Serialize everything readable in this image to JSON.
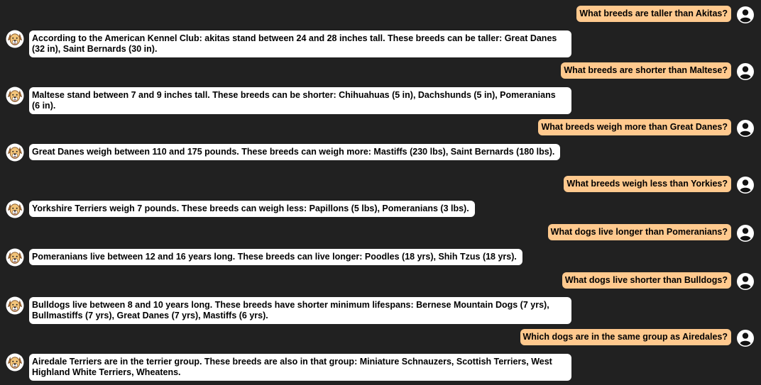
{
  "messages": [
    {
      "role": "user",
      "text": "What breeds are taller than Akitas?"
    },
    {
      "role": "bot",
      "text": "According to the American Kennel Club: akitas stand between 24 and 28 inches tall. These breeds can be taller: Great Danes (32 in), Saint Bernards (30 in)."
    },
    {
      "role": "user",
      "text": "What breeds are shorter than Maltese?"
    },
    {
      "role": "bot",
      "text": "Maltese stand between 7 and 9 inches tall. These breeds can be shorter: Chihuahuas (5 in), Dachshunds (5 in), Pomeranians (6 in)."
    },
    {
      "role": "user",
      "text": "What breeds weigh more than Great Danes?"
    },
    {
      "role": "bot",
      "text": "Great Danes weigh between 110 and 175 pounds. These breeds can weigh more: Mastiffs (230 lbs), Saint Bernards (180 lbs)."
    },
    {
      "role": "user",
      "text": "What breeds weigh less than Yorkies?"
    },
    {
      "role": "bot",
      "text": "Yorkshire Terriers weigh 7 pounds. These breeds can weigh less: Papillons (5 lbs), Pomeranians (3 lbs)."
    },
    {
      "role": "user",
      "text": "What dogs live longer than Pomeranians?"
    },
    {
      "role": "bot",
      "text": "Pomeranians live between 12 and 16 years long. These breeds can live longer: Poodles (18 yrs), Shih Tzus (18 yrs)."
    },
    {
      "role": "user",
      "text": "What dogs live shorter than Bulldogs?"
    },
    {
      "role": "bot",
      "text": "Bulldogs live between 8 and 10 years long. These breeds have shorter minimum lifespans: Bernese Mountain Dogs (7 yrs), Bullmastiffs (7 yrs), Great Danes (7 yrs), Mastiffs (6 yrs)."
    },
    {
      "role": "user",
      "text": "Which dogs are in the same group as Airedales?"
    },
    {
      "role": "bot",
      "text": "Airedale Terriers are in the terrier group. These breeds are also in that group: Miniature Schnauzers, Scottish Terriers, West Highland White Terriers, Wheatens."
    }
  ],
  "icons": {
    "user_avatar": "user-avatar-icon",
    "bot_avatar": "dog-avatar-icon"
  },
  "colors": {
    "background": "#212121",
    "user_bubble": "#ffc98e",
    "bot_bubble": "#ffffff",
    "dog_fur": "#f2c47a",
    "dog_outline": "#7a4a1e"
  }
}
